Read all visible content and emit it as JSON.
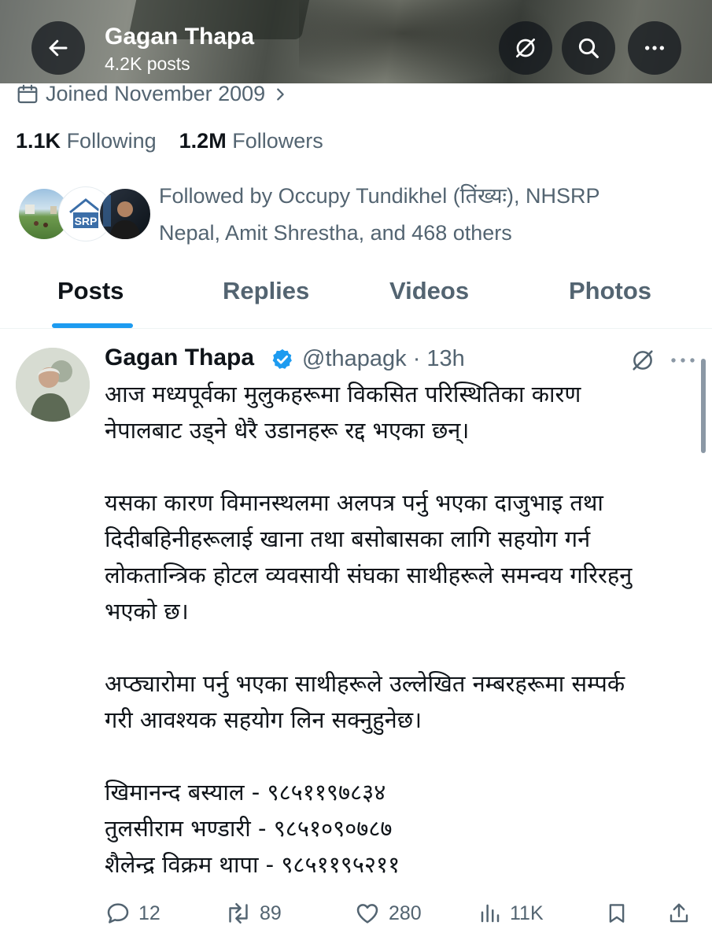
{
  "header": {
    "name": "Gagan Thapa",
    "posts_count": "4.2K posts"
  },
  "profile": {
    "joined": "Joined November 2009",
    "following_count": "1.1K",
    "following_label": "Following",
    "followers_count": "1.2M",
    "followers_label": "Followers",
    "followed_by": "Followed by Occupy Tundikhel (तिंख्यः), NHSRP Nepal, Amit Shrestha, and 468 others",
    "srp_logo_text": "SRP"
  },
  "tabs": [
    {
      "label": "Posts",
      "active": true
    },
    {
      "label": "Replies",
      "active": false
    },
    {
      "label": "Videos",
      "active": false
    },
    {
      "label": "Photos",
      "active": false
    }
  ],
  "post": {
    "author": "Gagan Thapa",
    "handle": "@thapagk",
    "time": "· 13h",
    "text": "आज मध्यपूर्वका मुलुकहरूमा विकसित परिस्थितिका कारण\nनेपालबाट उड्ने धेरै उडानहरू रद्द भएका छन्।\n\nयसका कारण विमानस्थलमा अलपत्र पर्नु भएका दाजुभाइ तथा\nदिदीबहिनीहरूलाई खाना तथा बसोबासका लागि सहयोग गर्न\nलोकतान्त्रिक होटल व्यवसायी संघका साथीहरूले समन्वय गरिरहनु\nभएको छ।\n\nअप्ठ्यारोमा पर्नु भएका साथीहरूले उल्लेखित नम्बरहरूमा सम्पर्क\nगरी आवश्यक सहयोग लिन सक्नुहुनेछ।\n\nखिमानन्द बस्याल - ९८५११९७८३४\nतुलसीराम भण्डारी - ९८५१०९०७८७\nशैलेन्द्र विक्रम थापा - ९८५११९५२११",
    "replies": "12",
    "reposts": "89",
    "likes": "280",
    "views": "11K"
  },
  "colors": {
    "accent": "#1d9bf0",
    "text": "#0f1419",
    "secondary": "#536471",
    "header_button": "#0f1419b8"
  }
}
